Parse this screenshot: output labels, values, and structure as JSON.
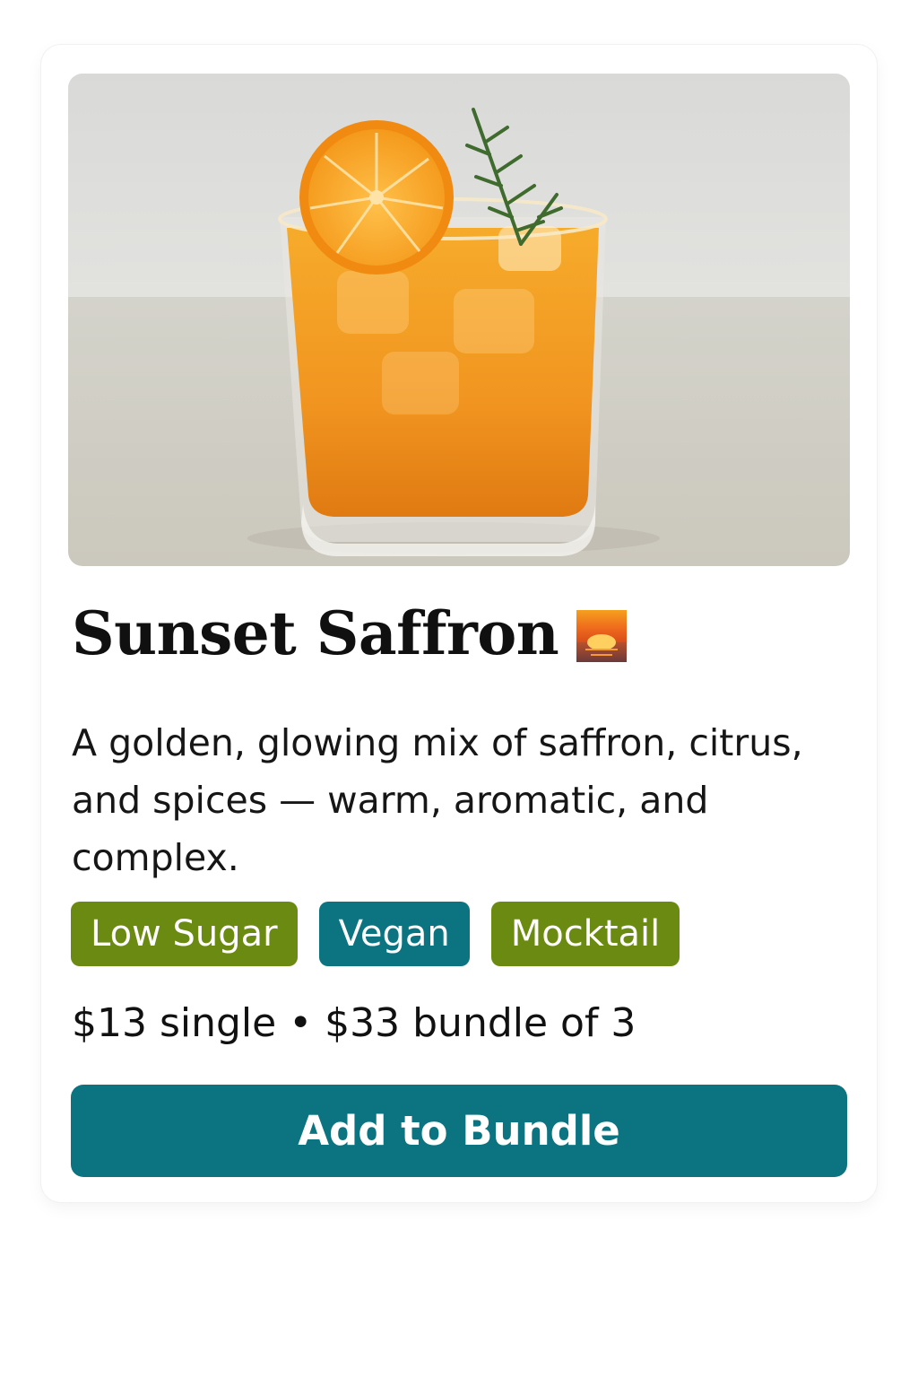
{
  "product": {
    "image_alt": "orange mocktail in a glass with an orange slice and rosemary sprig",
    "title": "Sunset Saffron",
    "title_icon": "sunset-icon",
    "description": "A golden, glowing mix of saffron, citrus, and spices — warm, aromatic, and complex.",
    "tags": [
      {
        "label": "Low Sugar",
        "color": "#6b8a12"
      },
      {
        "label": "Vegan",
        "color": "#0b7480"
      },
      {
        "label": "Mocktail",
        "color": "#6b8a12"
      }
    ],
    "price": "$13 single • $33 bundle of 3",
    "cta_label": "Add to Bundle"
  },
  "colors": {
    "accent": "#0b7480",
    "tag_green": "#6b8a12",
    "drink_orange": "#f39a1c"
  }
}
